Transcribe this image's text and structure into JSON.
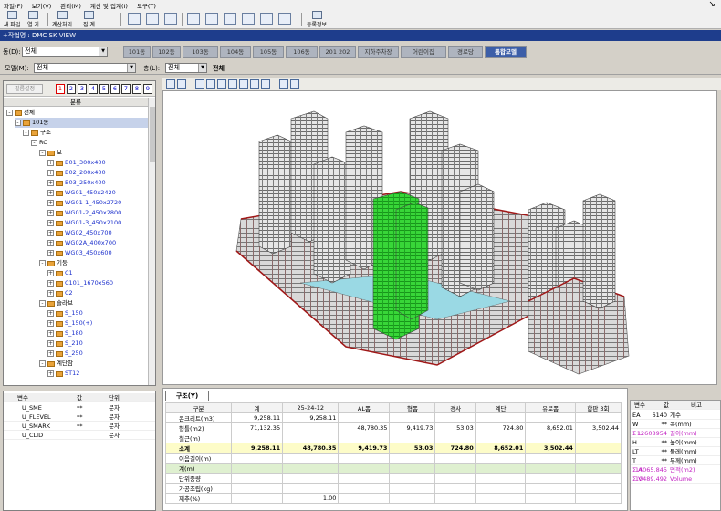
{
  "menu": [
    "파일(F)",
    "보기(V)",
    "관리(M)",
    "계산 및 집계(I)",
    "도구(T)"
  ],
  "toolbar": {
    "new": "새 파일",
    "open": "열 기",
    "calc": "계산처리",
    "total": "집 계",
    "register": "등록정보"
  },
  "window_title": "+작업명 : DMC SK VIEW",
  "building": {
    "label": "동(D):",
    "value": "전체"
  },
  "tabs": [
    "101동",
    "102동",
    "103동",
    "104동",
    "105동",
    "106동",
    "201 202",
    "지하주차장",
    "어린이집",
    "경로당",
    "통합모델"
  ],
  "active_tab": "통합모델",
  "model": {
    "label": "모델(M):",
    "value": "전체",
    "floor_label": "층(L):",
    "floor_value": "전체",
    "floor_text": "전체"
  },
  "left": {
    "filter_btn": "필름설정",
    "nums": [
      "1",
      "2",
      "3",
      "4",
      "5",
      "6",
      "7",
      "8",
      "9"
    ],
    "header": "분류"
  },
  "tree": [
    {
      "label": "전체",
      "level": 0,
      "pm": "-",
      "folder": true,
      "blue": false
    },
    {
      "label": "101동",
      "level": 1,
      "pm": "-",
      "folder": true,
      "blue": false,
      "sel": true
    },
    {
      "label": "구조",
      "level": 2,
      "pm": "-",
      "folder": true,
      "blue": false
    },
    {
      "label": "RC",
      "level": 3,
      "pm": "-",
      "folder": false,
      "blue": false
    },
    {
      "label": "보",
      "level": 4,
      "pm": "-",
      "folder": true,
      "blue": false
    },
    {
      "label": "B01_300x400",
      "level": 5,
      "pm": "+",
      "folder": true,
      "blue": true
    },
    {
      "label": "B02_200x400",
      "level": 5,
      "pm": "+",
      "folder": true,
      "blue": true
    },
    {
      "label": "B03_250x400",
      "level": 5,
      "pm": "+",
      "folder": true,
      "blue": true
    },
    {
      "label": "WG01_450x2420",
      "level": 5,
      "pm": "+",
      "folder": true,
      "blue": true
    },
    {
      "label": "WG01-1_450x2720",
      "level": 5,
      "pm": "+",
      "folder": true,
      "blue": true
    },
    {
      "label": "WG01-2_450x2800",
      "level": 5,
      "pm": "+",
      "folder": true,
      "blue": true
    },
    {
      "label": "WG01-3_450x2100",
      "level": 5,
      "pm": "+",
      "folder": true,
      "blue": true
    },
    {
      "label": "WG02_450x700",
      "level": 5,
      "pm": "+",
      "folder": true,
      "blue": true
    },
    {
      "label": "WG02A_400x700",
      "level": 5,
      "pm": "+",
      "folder": true,
      "blue": true
    },
    {
      "label": "WG03_450x600",
      "level": 5,
      "pm": "+",
      "folder": true,
      "blue": true
    },
    {
      "label": "기둥",
      "level": 4,
      "pm": "-",
      "folder": true,
      "blue": false
    },
    {
      "label": "C1",
      "level": 5,
      "pm": "+",
      "folder": true,
      "blue": true
    },
    {
      "label": "C101_1670x560",
      "level": 5,
      "pm": "+",
      "folder": true,
      "blue": true
    },
    {
      "label": "C2",
      "level": 5,
      "pm": "+",
      "folder": true,
      "blue": true
    },
    {
      "label": "슬라브",
      "level": 4,
      "pm": "-",
      "folder": true,
      "blue": false
    },
    {
      "label": "S_150",
      "level": 5,
      "pm": "+",
      "folder": true,
      "blue": true
    },
    {
      "label": "S_150(+)",
      "level": 5,
      "pm": "+",
      "folder": true,
      "blue": true
    },
    {
      "label": "S_180",
      "level": 5,
      "pm": "+",
      "folder": true,
      "blue": true
    },
    {
      "label": "S_210",
      "level": 5,
      "pm": "+",
      "folder": true,
      "blue": true
    },
    {
      "label": "S_250",
      "level": 5,
      "pm": "+",
      "folder": true,
      "blue": true
    },
    {
      "label": "계단참",
      "level": 4,
      "pm": "-",
      "folder": true,
      "blue": false
    },
    {
      "label": "ST12",
      "level": 5,
      "pm": "+",
      "folder": true,
      "blue": true
    }
  ],
  "vars": {
    "headers": [
      "변수",
      "값",
      "단위"
    ],
    "rows": [
      [
        "U_SME",
        "**",
        "문자"
      ],
      [
        "U_FLEVEL",
        "**",
        "문자"
      ],
      [
        "U_SMARK",
        "**",
        "문자"
      ],
      [
        "U_CLID",
        "",
        "문자"
      ]
    ]
  },
  "bottom": {
    "tab": "구조(Y)",
    "columns": [
      "구분",
      "계",
      "25-24-12",
      "AL폼",
      "형폼",
      "경사",
      "계단",
      "유로폼",
      "합판 3회"
    ],
    "rows": [
      {
        "cells": [
          "콘크리트(m3)",
          "9,258.11",
          "9,258.11",
          "",
          "",
          "",
          "",
          "",
          ""
        ],
        "type": ""
      },
      {
        "cells": [
          "형틀(m2)",
          "71,132.35",
          "",
          "48,780.35",
          "9,419.73",
          "53.03",
          "724.80",
          "8,652.01",
          "3,502.44"
        ],
        "type": ""
      },
      {
        "cells": [
          "철근(m)",
          "",
          "",
          "",
          "",
          "",
          "",
          "",
          ""
        ],
        "type": ""
      },
      {
        "cells": [
          "소계",
          "9,258.11",
          "48,780.35",
          "9,419.73",
          "53.03",
          "724.80",
          "8,652.01",
          "3,502.44",
          ""
        ],
        "type": "sub"
      },
      {
        "cells": [
          "이음길이(m)",
          "",
          "",
          "",
          "",
          "",
          "",
          "",
          ""
        ],
        "type": ""
      },
      {
        "cells": [
          "계(m)",
          "",
          "",
          "",
          "",
          "",
          "",
          "",
          ""
        ],
        "type": "green"
      },
      {
        "cells": [
          "단위중량",
          "",
          "",
          "",
          "",
          "",
          "",
          "",
          ""
        ],
        "type": ""
      },
      {
        "cells": [
          "가공조립(kg)",
          "",
          "",
          "",
          "",
          "",
          "",
          "",
          ""
        ],
        "type": ""
      },
      {
        "cells": [
          "재추(%)",
          "",
          "1.00",
          "",
          "",
          "",
          "",
          "",
          ""
        ],
        "type": ""
      }
    ]
  },
  "props": {
    "headers": [
      "변수",
      "값",
      "비고"
    ],
    "rows": [
      {
        "k": "EA",
        "v": "6140",
        "n": "개수",
        "mag": false
      },
      {
        "k": "W",
        "v": "**",
        "n": "폭(mm)",
        "mag": false
      },
      {
        "k": "Σ L",
        "v": "12608954",
        "n": "길이(mm)",
        "mag": true
      },
      {
        "k": "H",
        "v": "**",
        "n": "높이(mm)",
        "mag": false
      },
      {
        "k": "LT",
        "v": "**",
        "n": "둘레(mm)",
        "mag": false
      },
      {
        "k": "T",
        "v": "**",
        "n": "두께(mm)",
        "mag": false
      },
      {
        "k": "Σ A",
        "v": "14065.845",
        "n": "면적(m2)",
        "mag": true
      },
      {
        "k": "Σ V",
        "v": "10489.492",
        "n": "Volume",
        "mag": true
      }
    ]
  },
  "colors": {
    "title_bg": "#1e3d8c",
    "active_tab": "#3c5ea8",
    "highlight": "#33d633",
    "subtotal": "#fdfcc8"
  }
}
